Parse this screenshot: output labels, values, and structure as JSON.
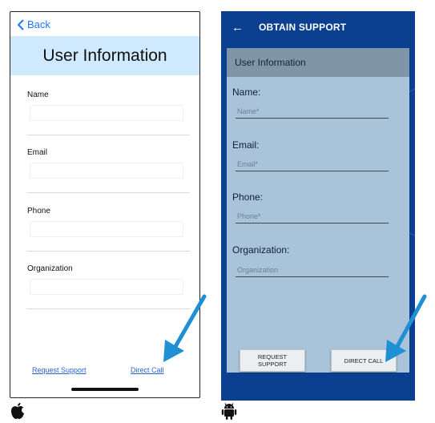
{
  "ios": {
    "back_label": "Back",
    "header_title": "User Information",
    "fields": [
      {
        "label": "Name"
      },
      {
        "label": "Email"
      },
      {
        "label": "Phone"
      },
      {
        "label": "Organization"
      }
    ],
    "request_support_link": "Request Support",
    "direct_call_link": "Direct Call"
  },
  "android": {
    "app_bar_title": "OBTAIN SUPPORT",
    "card_title": "User Information",
    "fields": [
      {
        "label": "Name:",
        "placeholder": "Name*"
      },
      {
        "label": "Email:",
        "placeholder": "Email*"
      },
      {
        "label": "Phone:",
        "placeholder": "Phone*"
      },
      {
        "label": "Organization:",
        "placeholder": "Organization"
      }
    ],
    "request_support_button": "REQUEST SUPPORT",
    "direct_call_button": "DIRECT CALL"
  },
  "colors": {
    "ios_link": "#2a63d6",
    "ios_header_bg": "#cfeaff",
    "android_bg": "#0b3f8f",
    "android_card": "#a9c3d8",
    "pointer_arrow": "#1f8fd6"
  },
  "icons": [
    "back-chevron-icon",
    "back-arrow-icon",
    "apple-logo-icon",
    "android-logo-icon",
    "pointer-arrow-icon"
  ]
}
